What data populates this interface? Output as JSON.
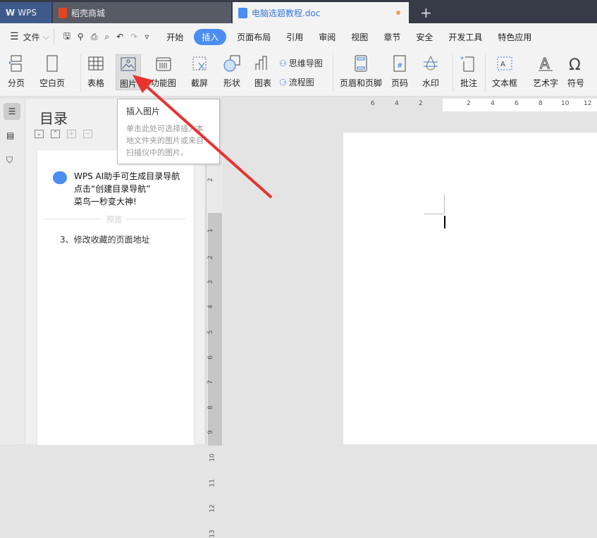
{
  "tabs": [
    {
      "label": "WPS"
    },
    {
      "label": "稻壳商城"
    },
    {
      "label": "电脑选题教程.doc"
    }
  ],
  "new_tab": "+",
  "menu": {
    "file": "文件",
    "items": [
      "开始",
      "插入",
      "页面布局",
      "引用",
      "审阅",
      "视图",
      "章节",
      "安全",
      "开发工具",
      "特色应用"
    ],
    "active": "插入"
  },
  "ribbon": {
    "page_break": "分页",
    "blank_page": "空白页",
    "table": "表格",
    "picture": "图片",
    "function_chart": "功能图",
    "screenshot": "截屏",
    "shape": "形状",
    "chart": "图表",
    "mind_map": "思维导图",
    "flowchart": "流程图",
    "header_footer": "页眉和页脚",
    "page_number": "页码",
    "watermark": "水印",
    "comment": "批注",
    "textbox": "文本框",
    "wordart": "艺术字",
    "symbol": "符号"
  },
  "tooltip": {
    "title": "插入图片",
    "body": "单击此处可选择插入本地文件夹的图片或来自扫描仪中的图片。"
  },
  "toc": {
    "title": "目录",
    "ai_line1": "WPS AI助手可生成目录导航",
    "ai_line2": "点击“创建目录导航”",
    "ai_line3": "菜鸟一秒变大神!",
    "preview": "预览",
    "item": "3、修改收藏的页面地址"
  },
  "hruler": [
    "6",
    "4",
    "2",
    "2",
    "4",
    "6",
    "8",
    "10",
    "12"
  ],
  "vruler": [
    "2",
    "1",
    "1",
    "2",
    "3",
    "4",
    "5",
    "6",
    "7",
    "8",
    "9",
    "10",
    "11",
    "12",
    "13"
  ],
  "colors": {
    "accent": "#4b8df2",
    "arrow": "#e8322f"
  }
}
